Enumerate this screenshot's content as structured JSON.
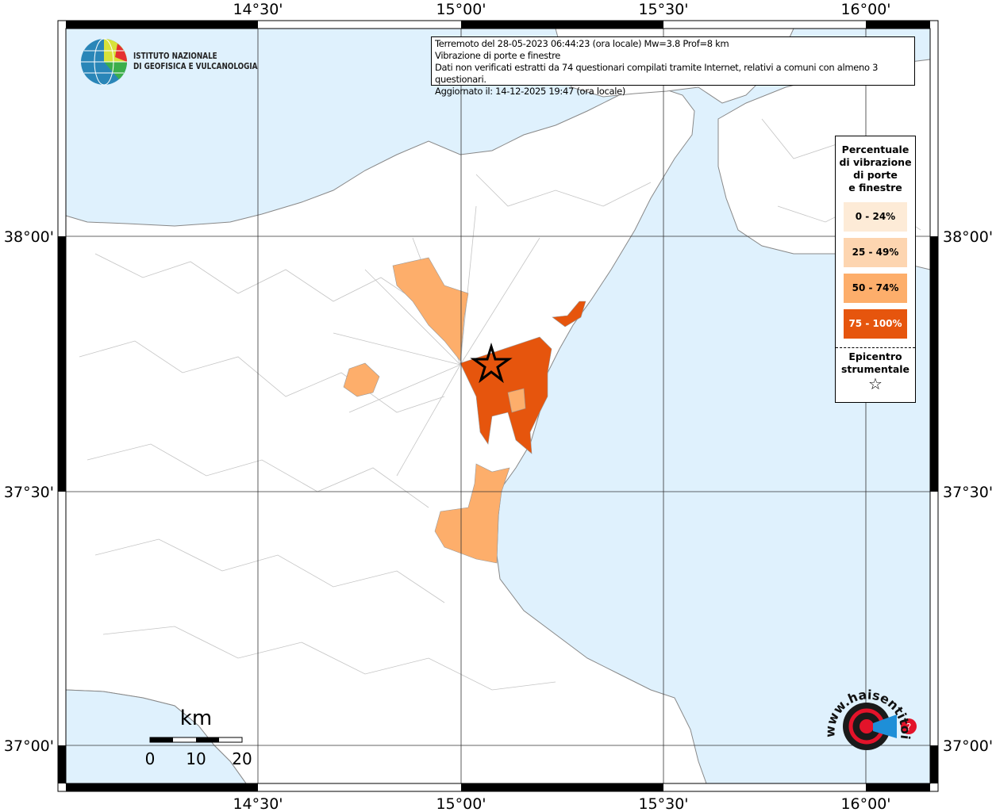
{
  "header": {
    "info_lines": [
      "Terremoto del 28-05-2023 06:44:23 (ora locale) Mw=3.8 Prof=8 km",
      "Vibrazione di porte e finestre",
      "Dati non verificati estratti da 74 questionari compilati tramite Internet, relativi a comuni con almeno 3 questionari.",
      "Aggiornato il: 14-12-2025 19:47 (ora locale)"
    ]
  },
  "logo": {
    "line1": "ISTITUTO NAZIONALE",
    "line2": "DI GEOFISICA E VULCANOLOGIA"
  },
  "legend": {
    "title_lines": [
      "Percentuale",
      "di vibrazione",
      "di porte",
      "e finestre"
    ],
    "classes": [
      {
        "label": "0 - 24%",
        "color": "#fdebd7"
      },
      {
        "label": "25 - 49%",
        "color": "#fdd5b0"
      },
      {
        "label": "50 - 74%",
        "color": "#fdae6b"
      },
      {
        "label": "75 - 100%",
        "color": "#e6550d"
      }
    ],
    "epicenter_lines": [
      "Epicentro",
      "strumentale"
    ]
  },
  "axes": {
    "lon_labels": [
      "14°30'",
      "15°00'",
      "15°30'",
      "16°00'"
    ],
    "lat_labels": [
      "38°00'",
      "37°30'",
      "37°00'"
    ]
  },
  "scale_bar": {
    "unit": "km",
    "ticks": [
      "0",
      "10",
      "20"
    ]
  },
  "watermark": "www.haisentitoilterremoto.it",
  "colors": {
    "sea": "#dff1fd",
    "land": "#ffffff",
    "border": "#b0b0b0"
  }
}
